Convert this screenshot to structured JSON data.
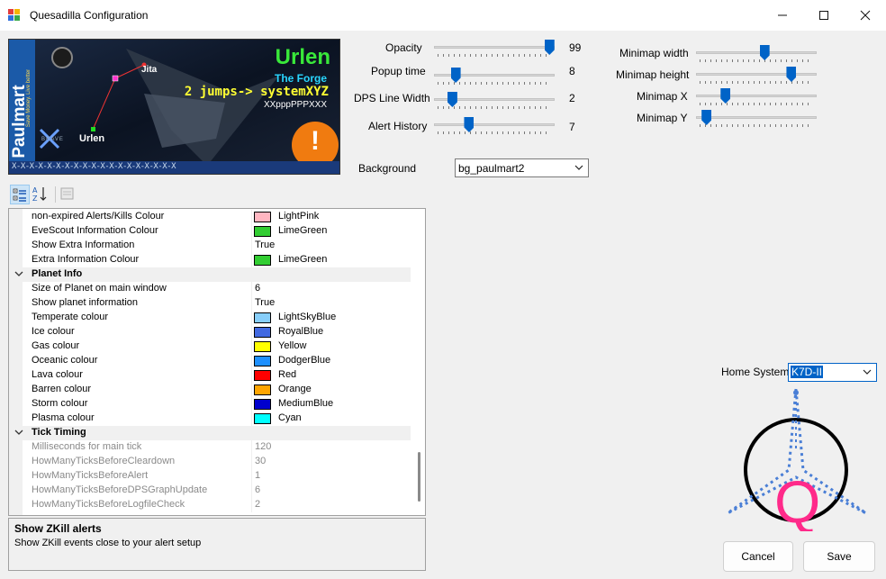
{
  "window": {
    "title": "Quesadilla Configuration",
    "minimize_icon": "minimize-icon",
    "maximize_icon": "maximize-icon",
    "close_icon": "close-icon"
  },
  "banner": {
    "brand": "Paulmart",
    "slogan": "Save Money. Live better",
    "system": "Urlen",
    "region": "The Forge",
    "jumps": "2 jumps-> systemXYZ",
    "subline": "XXpppPPPXXX",
    "node_top": "Jita",
    "node_bottom": "Urlen",
    "corp": "BRAVE",
    "footer": "X-X-X-X-X-X-X-X-X-X-X-X-X-X-X-X-X-X-X",
    "alert_glyph": "!"
  },
  "sliders": [
    {
      "label": "Opacity",
      "value": "99",
      "fraction": 0.99
    },
    {
      "label": "Popup time",
      "value": "8",
      "fraction": 0.15
    },
    {
      "label": "DPS Line Width",
      "value": "2",
      "fraction": 0.12
    },
    {
      "label": "Alert History",
      "value": "7",
      "fraction": 0.27
    }
  ],
  "minimap": [
    {
      "label": "Minimap width",
      "fraction": 0.57
    },
    {
      "label": "Minimap height",
      "fraction": 0.81
    },
    {
      "label": "Minimap X",
      "fraction": 0.22
    },
    {
      "label": "Minimap Y",
      "fraction": 0.05
    }
  ],
  "background": {
    "label": "Background",
    "value": "bg_paulmart2"
  },
  "home_system": {
    "label": "Home System",
    "value": "K7D-II"
  },
  "logo_letter": "Q",
  "toolbar": {
    "categorized_icon": "categorized-icon",
    "alphabetical_icon": "sort-alpha-icon",
    "pages_icon": "property-pages-icon"
  },
  "grid": {
    "rows": [
      {
        "type": "prop",
        "name": "non-expired Alerts/Kills Colour",
        "value": "LightPink",
        "color": "#ffb6c1"
      },
      {
        "type": "prop",
        "name": "EveScout Information Colour",
        "value": "LimeGreen",
        "color": "#32cd32"
      },
      {
        "type": "prop",
        "name": "Show Extra Information",
        "value": "True"
      },
      {
        "type": "prop",
        "name": "Extra Information Colour",
        "value": "LimeGreen",
        "color": "#32cd32"
      },
      {
        "type": "cat",
        "name": "Planet Info"
      },
      {
        "type": "prop",
        "name": "Size of Planet on main window",
        "value": "6"
      },
      {
        "type": "prop",
        "name": "Show planet information",
        "value": "True"
      },
      {
        "type": "prop",
        "name": "Temperate colour",
        "value": "LightSkyBlue",
        "color": "#87cefa"
      },
      {
        "type": "prop",
        "name": "Ice colour",
        "value": "RoyalBlue",
        "color": "#4169e1"
      },
      {
        "type": "prop",
        "name": "Gas colour",
        "value": "Yellow",
        "color": "#ffff00"
      },
      {
        "type": "prop",
        "name": "Oceanic colour",
        "value": "DodgerBlue",
        "color": "#1e90ff"
      },
      {
        "type": "prop",
        "name": "Lava colour",
        "value": "Red",
        "color": "#ff0000"
      },
      {
        "type": "prop",
        "name": "Barren colour",
        "value": "Orange",
        "color": "#ffa500"
      },
      {
        "type": "prop",
        "name": "Storm colour",
        "value": "MediumBlue",
        "color": "#0000cd"
      },
      {
        "type": "prop",
        "name": "Plasma colour",
        "value": "Cyan",
        "color": "#00ffff"
      },
      {
        "type": "cat",
        "name": "Tick Timing"
      },
      {
        "type": "dis",
        "name": "Milliseconds for main tick",
        "value": "120"
      },
      {
        "type": "dis",
        "name": "HowManyTicksBeforeCleardown",
        "value": "30"
      },
      {
        "type": "dis",
        "name": "HowManyTicksBeforeAlert",
        "value": "1"
      },
      {
        "type": "dis",
        "name": "HowManyTicksBeforeDPSGraphUpdate",
        "value": "6"
      },
      {
        "type": "dis",
        "name": "HowManyTicksBeforeLogfileCheck",
        "value": "2"
      }
    ]
  },
  "help": {
    "title": "Show ZKill alerts",
    "text": "Show ZKill events close to your alert setup"
  },
  "buttons": {
    "cancel": "Cancel",
    "save": "Save"
  }
}
